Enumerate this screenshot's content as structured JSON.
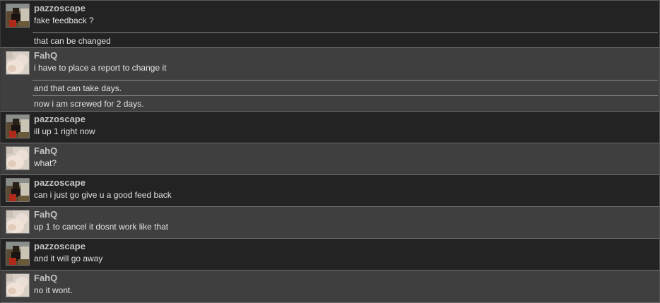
{
  "conversation": [
    {
      "user": "pazzoscape",
      "avatar_icon": "pazzoscape-avatar-icon",
      "lines": [
        "fake feedback ?",
        "that can be changed"
      ]
    },
    {
      "user": "FahQ",
      "avatar_icon": "fahq-avatar-icon",
      "lines": [
        "i have to place a report to change it",
        "and that can take days.",
        "now i am screwed for 2 days."
      ]
    },
    {
      "user": "pazzoscape",
      "avatar_icon": "pazzoscape-avatar-icon",
      "lines": [
        "ill up 1 right now"
      ]
    },
    {
      "user": "FahQ",
      "avatar_icon": "fahq-avatar-icon",
      "lines": [
        "what?"
      ]
    },
    {
      "user": "pazzoscape",
      "avatar_icon": "pazzoscape-avatar-icon",
      "lines": [
        "can i just go give u a good feed back"
      ]
    },
    {
      "user": "FahQ",
      "avatar_icon": "fahq-avatar-icon",
      "lines": [
        "up 1 to cancel it dosnt work like that"
      ]
    },
    {
      "user": "pazzoscape",
      "avatar_icon": "pazzoscape-avatar-icon",
      "lines": [
        "and it will go away"
      ]
    },
    {
      "user": "FahQ",
      "avatar_icon": "fahq-avatar-icon",
      "lines": [
        "no it wont."
      ]
    }
  ],
  "colors": {
    "dark_row": "#232323",
    "light_row": "#3f3f3f",
    "username": "#c4c4c4",
    "message_text": "#e2e2e2"
  }
}
